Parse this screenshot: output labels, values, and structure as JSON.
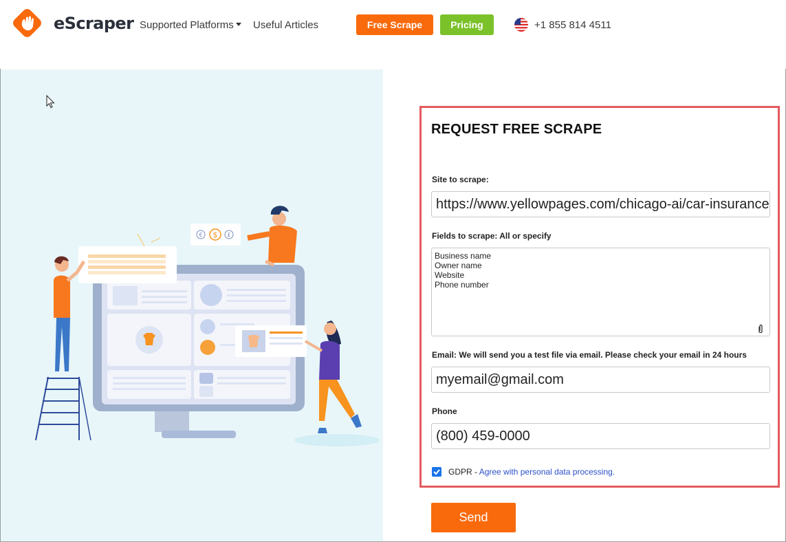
{
  "header": {
    "brand": "eScraper",
    "nav": {
      "supported_platforms": "Supported Platforms",
      "useful_articles": "Useful Articles"
    },
    "free_scrape_button": "Free Scrape",
    "pricing_button": "Pricing",
    "phone": "+1 855 814 4511",
    "flag_icon": "us-flag-icon"
  },
  "colors": {
    "accent_orange": "#f96a0c",
    "accent_green": "#7bc12a",
    "highlight_border": "#e45a5f",
    "illustration_bg": "#e8f6fa"
  },
  "form": {
    "title": "REQUEST FREE SCRAPE",
    "site_label": "Site to scrape:",
    "site_value": "https://www.yellowpages.com/chicago-ai/car-insurance",
    "fields_label": "Fields to scrape: All or specify",
    "fields_lines": [
      "Business name",
      "Owner name",
      "Website",
      "Phone number"
    ],
    "email_label": "Email: We will send you a test file via email. Please check your email in 24 hours",
    "email_value": "myemail@gmail.com",
    "phone_label": "Phone",
    "phone_value": "(800) 459-0000",
    "gdpr_checked": true,
    "gdpr_label": "GDPR",
    "gdpr_separator": " - ",
    "gdpr_link": "Agree with personal data processing.",
    "send_button": "Send"
  },
  "illustration": {
    "currency_symbols": [
      "€",
      "$",
      "£"
    ]
  }
}
